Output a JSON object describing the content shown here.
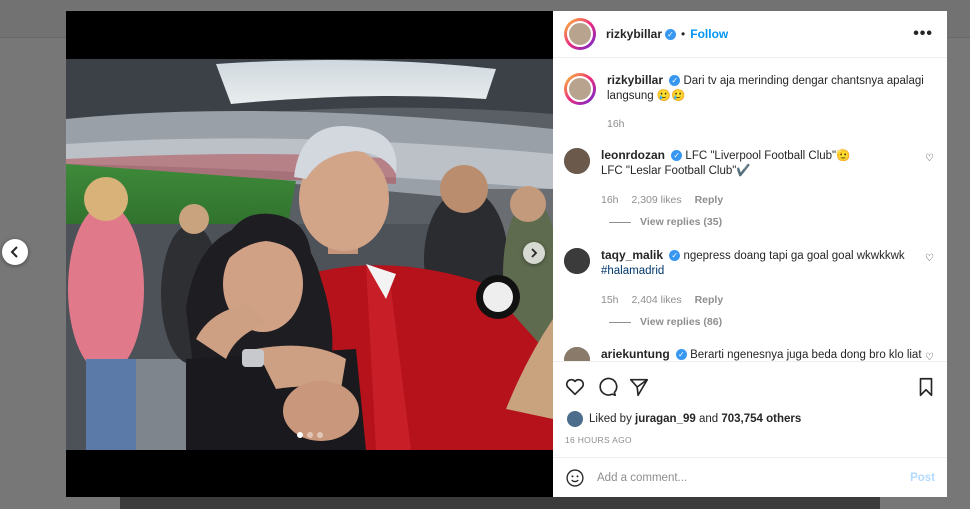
{
  "post": {
    "username": "rizkybillar",
    "follow_label": "Follow",
    "separator": "•"
  },
  "caption": {
    "username": "rizkybillar",
    "text": "Dari tv aja merinding dengar chantsnya apalagi langsung 🥲🥲",
    "time": "16h"
  },
  "comments": [
    {
      "username": "leonrdozan",
      "text_line1": "LFC \"Liverpool Football Club\"🫡",
      "text_line2": "LFC \"Leslar Football Club\"✔️",
      "time": "16h",
      "likes": "2,309 likes",
      "reply": "Reply",
      "view_replies": "View replies (35)"
    },
    {
      "username": "taqy_malik",
      "text_line1": "ngepress doang tapi ga goal goal wkwkkwk",
      "text_line2": "#halamadrid",
      "time": "15h",
      "likes": "2,404 likes",
      "reply": "Reply",
      "view_replies": "View replies (86)"
    },
    {
      "username": "ariekuntung",
      "text_line1": "Berarti ngenesnya juga beda dong bro klo liat"
    }
  ],
  "likes_summary": {
    "prefix": "Liked by",
    "user": "juragan_99",
    "middle": "and",
    "count": "703,754 others"
  },
  "time_ago": "16 HOURS AGO",
  "add_comment": {
    "placeholder": "Add a comment...",
    "post_label": "Post"
  },
  "carousel": {
    "slide_count": 3,
    "current_slide": 1
  },
  "icons": [
    "more-options-icon",
    "verified-badge-icon",
    "heart-icon",
    "comment-icon",
    "share-icon",
    "bookmark-icon",
    "emoji-icon",
    "chevron-left-icon",
    "chevron-right-icon"
  ],
  "colors": {
    "link": "#0095f6",
    "verified": "#3897f0",
    "muted": "#8e8e8e",
    "text": "#262626",
    "post_disabled": "#b3dbff"
  }
}
